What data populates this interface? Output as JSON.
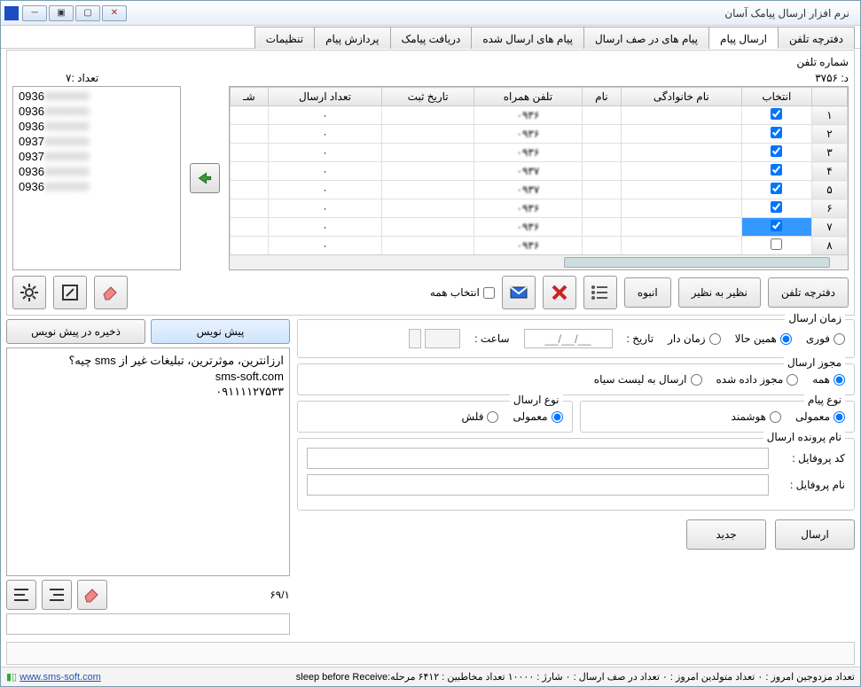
{
  "title": "نرم افزار ارسال پیامک آسان",
  "tabs": [
    "دفترچه تلفن",
    "ارسال پیام",
    "پیام های در صف ارسال",
    "پیام های ارسال شده",
    "دریافت پیامک",
    "پردازش پیام",
    "تنظیمات"
  ],
  "active_tab": 1,
  "phone_title": "شماره تلفن",
  "phone_count": "د: ۳۷۵۶",
  "left_count": "تعداد :۷",
  "left_numbers": [
    "0936",
    "0936",
    "0936",
    "0937",
    "0937",
    "0936",
    "0936"
  ],
  "columns": {
    "sel": "انتخاب",
    "fam": "نام خانوادگی",
    "name": "نام",
    "mob": "تلفن همراه",
    "reg": "تاریخ ثبت",
    "cnt": "تعداد ارسال",
    "sh": "شـ"
  },
  "rows": [
    {
      "n": "۱",
      "sel": true,
      "mob": "۰۹۳۶",
      "cnt": "·"
    },
    {
      "n": "۲",
      "sel": true,
      "mob": "۰۹۳۶",
      "cnt": "·"
    },
    {
      "n": "۳",
      "sel": true,
      "mob": "۰۹۳۶",
      "cnt": "·"
    },
    {
      "n": "۴",
      "sel": true,
      "mob": "۰۹۳۷",
      "cnt": "·"
    },
    {
      "n": "۵",
      "sel": true,
      "mob": "۰۹۳۷",
      "cnt": "·"
    },
    {
      "n": "۶",
      "sel": true,
      "mob": "۰۹۳۶",
      "cnt": "·"
    },
    {
      "n": "۷",
      "sel": true,
      "mob": "۰۹۳۶",
      "cnt": "·",
      "selected": true
    },
    {
      "n": "۸",
      "sel": false,
      "mob": "۰۹۳۶",
      "cnt": "·"
    }
  ],
  "select_all": "انتخاب همه",
  "btn": {
    "phonebook": "دفترچه تلفن",
    "one2one": "نظیر به نظیر",
    "bulk": "انبوه",
    "draft": "پیش نویس",
    "save_draft": "ذخیره در پیش نویس",
    "send": "ارسال",
    "new": "جدید"
  },
  "send_time": {
    "legend": "زمان ارسال",
    "immediate": "فوری",
    "now": "همین حالا",
    "scheduled": "زمان دار",
    "date_lbl": "تاریخ :",
    "date_val": "__/__/__",
    "time_lbl": "ساعت :"
  },
  "send_perm": {
    "legend": "مجوز ارسال",
    "all": "همه",
    "permitted": "مجوز داده شده",
    "blacklist": "ارسال به لیست سیاه"
  },
  "msg_type": {
    "legend": "نوع پیام",
    "normal": "معمولی",
    "smart": "هوشمند"
  },
  "send_type": {
    "legend": "نوع ارسال",
    "normal": "معمولی",
    "flash": "فلش"
  },
  "profile": {
    "legend": "نام پرونده ارسال",
    "code": "کد پروفایل :",
    "name": "نام پروفایل :"
  },
  "msg_lines": [
    "ارزانترین، موثرترین، تبلیغات غیر از sms چیه؟",
    "sms-soft.com",
    "۰۹۱۱۱۱۲۷۵۳۳"
  ],
  "msg_counter": "۶۹/۱",
  "status": {
    "url": "www.sms-soft.com",
    "text": " تعداد مزدوجین امروز : ۰  تعداد متولدین امروز : ۰  تعداد در صف ارسال : ۰  شارژ : ۱۰۰۰۰  تعداد مخاطبین : ۶۴۱۲  مرحله:sleep before Receive"
  }
}
